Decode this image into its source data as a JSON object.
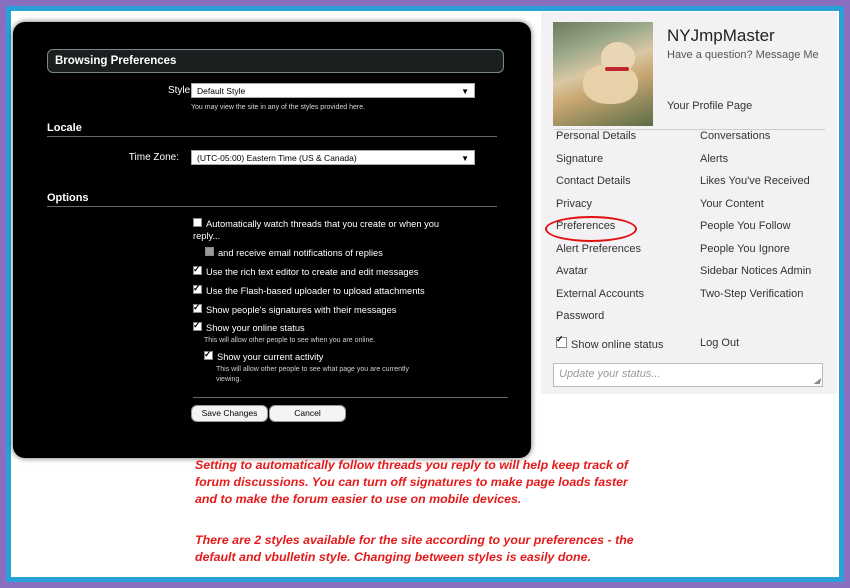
{
  "prefs": {
    "section_title": "Browsing Preferences",
    "style_label": "Style:",
    "style_value": "Default Style",
    "style_hint": "You may view the site in any of the styles provided here.",
    "locale_heading": "Locale",
    "timezone_label": "Time Zone:",
    "timezone_value": "(UTC-05:00) Eastern Time (US & Canada)",
    "options_heading": "Options",
    "options": [
      {
        "label": "Automatically watch threads that you create or when you",
        "label2": "reply...",
        "checked": false
      },
      {
        "label": "and receive email notifications of replies",
        "checked": false
      },
      {
        "label": "Use the rich text editor to create and edit messages",
        "checked": true
      },
      {
        "label": "Use the Flash-based uploader to upload attachments",
        "checked": true
      },
      {
        "label": "Show people's signatures with their messages",
        "checked": true
      },
      {
        "label": "Show your online status",
        "checked": true,
        "hint": "This will allow other people to see when you are online."
      },
      {
        "label": "Show your current activity",
        "checked": true,
        "hint": "This will allow other people to see what page you are currently",
        "hint2": "viewing."
      }
    ],
    "save_label": "Save Changes",
    "cancel_label": "Cancel"
  },
  "profile": {
    "username": "NYJmpMaster",
    "tagline": "Have a question? Message Me",
    "profile_page": "Your Profile Page",
    "left_nav": [
      "Personal Details",
      "Signature",
      "Contact Details",
      "Privacy",
      "Preferences",
      "Alert Preferences",
      "Avatar",
      "External Accounts",
      "Password"
    ],
    "right_nav": [
      "Conversations",
      "Alerts",
      "Likes You've Received",
      "Your Content",
      "People You Follow",
      "People You Ignore",
      "Sidebar Notices Admin",
      "Two-Step Verification"
    ],
    "online_status_label": "Show online status",
    "logout_label": "Log Out",
    "status_placeholder": "Update your status..."
  },
  "caption": {
    "lines1": [
      "Setting to automatically follow threads you reply to will help keep track of",
      "forum discussions.   You can turn off signatures to make page loads faster",
      "and to make the forum easier to use on mobile devices."
    ],
    "lines2": [
      "There are 2 styles available for the site according to your preferences - the",
      "default and vbulletin style. Changing between styles is easily done."
    ]
  },
  "colors": {
    "caption": "#e41b1b",
    "highlight_ring": "#e01010",
    "frame_outer": "#8a6fc0",
    "frame_inner": "#2aa0d8"
  },
  "icons": [
    "checkbox-icon",
    "dropdown-arrow-icon",
    "resize-grip-icon"
  ]
}
